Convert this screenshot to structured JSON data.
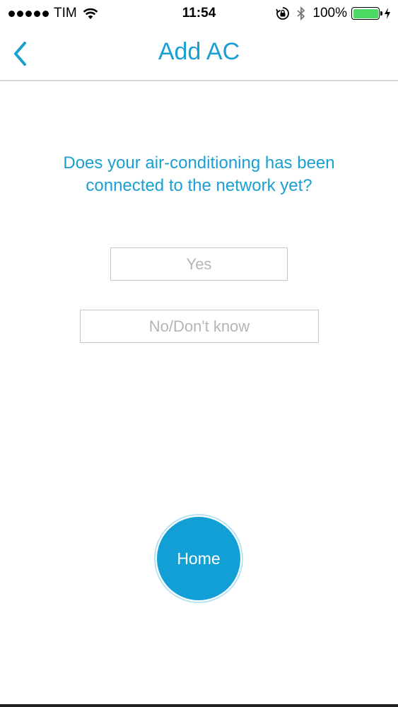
{
  "status_bar": {
    "carrier": "TIM",
    "time": "11:54",
    "battery_percent": "100%",
    "battery_level": 1.0,
    "battery_color": "#4cd964",
    "icons": [
      "signal-dots-icon",
      "wifi-icon",
      "rotation-lock-icon",
      "bluetooth-icon",
      "battery-icon",
      "charging-bolt-icon"
    ]
  },
  "nav": {
    "title": "Add AC",
    "back_icon": "chevron-left-icon",
    "accent_color": "#199fd2"
  },
  "main": {
    "question": "Does your air-conditioning has been connected to the network yet?",
    "yes_label": "Yes",
    "no_label": "No/Don't know",
    "home_label": "Home",
    "home_color": "#129fd6"
  }
}
